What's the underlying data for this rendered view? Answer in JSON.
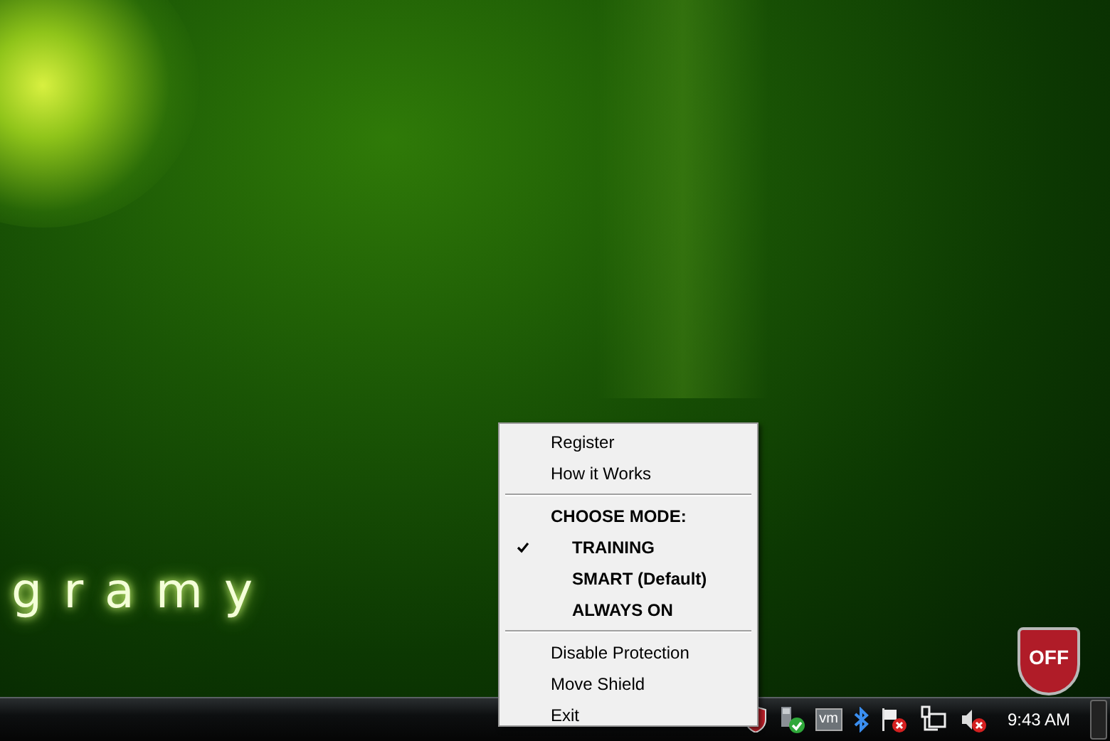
{
  "wallpaper": {
    "text": "gramy"
  },
  "shield": {
    "label": "OFF"
  },
  "menu": {
    "items": [
      {
        "kind": "item",
        "label": "Register"
      },
      {
        "kind": "item",
        "label": "How it Works"
      },
      {
        "kind": "separator"
      },
      {
        "kind": "heading",
        "label": "CHOOSE MODE:"
      },
      {
        "kind": "mode",
        "label": "TRAINING",
        "selected": true
      },
      {
        "kind": "mode",
        "label": "SMART (Default)",
        "selected": false
      },
      {
        "kind": "mode",
        "label": "ALWAYS ON",
        "selected": false
      },
      {
        "kind": "separator"
      },
      {
        "kind": "item",
        "label": "Disable Protection"
      },
      {
        "kind": "item",
        "label": "Move Shield"
      },
      {
        "kind": "item",
        "label": "Exit"
      }
    ]
  },
  "taskbar": {
    "vm_icon_text": "vm",
    "clock": "9:43 AM"
  }
}
